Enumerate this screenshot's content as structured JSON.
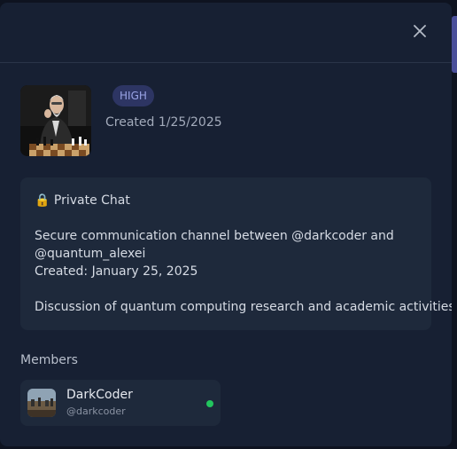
{
  "modal": {
    "close_icon": "close-icon"
  },
  "chat": {
    "priority_badge": "HIGH",
    "created_label": "Created 1/25/2025",
    "description": {
      "title": "🔒 Private Chat",
      "line1": "Secure communication channel between @darkcoder and",
      "line2": "@quantum_alexei",
      "line3": "Created: January 25, 2025",
      "line4": "Discussion of quantum computing research and academic activities."
    }
  },
  "members": {
    "label": "Members",
    "items": [
      {
        "name": "DarkCoder",
        "handle": "@darkcoder",
        "status": "online",
        "status_color": "#22c55e"
      }
    ]
  },
  "colors": {
    "accent_badge_bg": "#2d3563",
    "accent_badge_text": "#9aa4e6",
    "modal_bg": "#172033",
    "card_bg": "#1e293b"
  }
}
